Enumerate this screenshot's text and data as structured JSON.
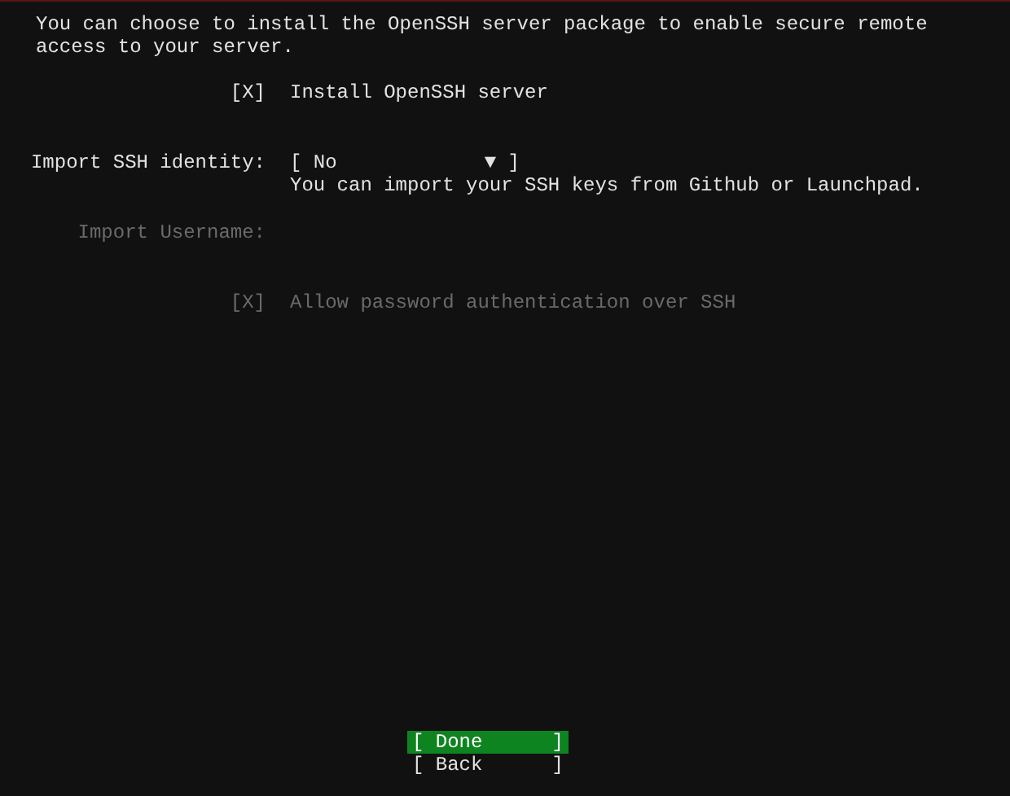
{
  "intro": "You can choose to install the OpenSSH server package to enable secure remote access to your server.",
  "install_option": {
    "open": "[",
    "glyph": "X",
    "close": "]",
    "checked": true,
    "disabled": false,
    "label": "Install OpenSSH server"
  },
  "identity": {
    "label": "Import SSH identity:",
    "open": "[",
    "value": "No",
    "arrow": "▼",
    "close": "]",
    "hint": "You can import your SSH keys from Github or Launchpad."
  },
  "username": {
    "label": "Import Username:",
    "disabled": true
  },
  "password_option": {
    "open": "[",
    "glyph": "X",
    "close": "]",
    "checked": true,
    "disabled": true,
    "label": "Allow password authentication over SSH"
  },
  "buttons": [
    {
      "open": "[",
      "label": "Done",
      "close": "]",
      "selected": true
    },
    {
      "open": "[",
      "label": "Back",
      "close": "]",
      "selected": false
    }
  ]
}
